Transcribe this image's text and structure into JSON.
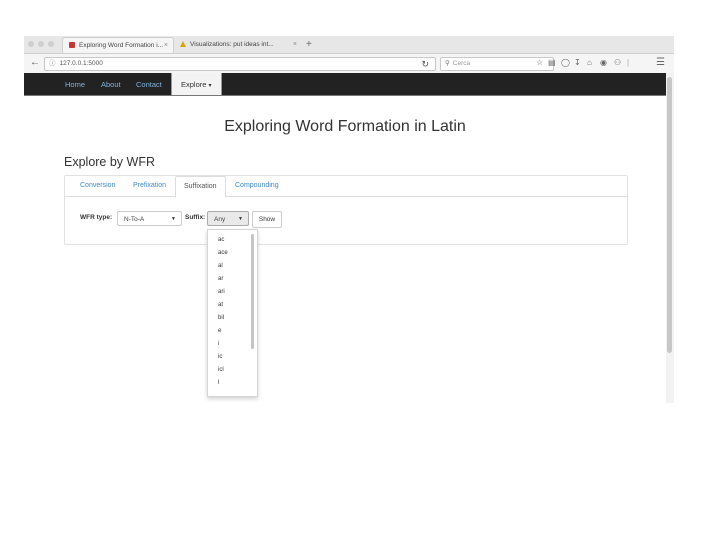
{
  "browser": {
    "tabs": [
      {
        "title": "Exploring Word Formation i...",
        "close": "×"
      },
      {
        "title": "Visualizations: put ideas int...",
        "close": "×"
      }
    ],
    "new_tab": "+",
    "url": "127.0.0.1:5000",
    "search_placeholder": "Cerca",
    "icons": [
      "star-icon",
      "reading-list-icon",
      "pocket-icon",
      "download-icon",
      "home-icon",
      "chat-icon",
      "extension-icon",
      "menu-icon"
    ]
  },
  "site_nav": {
    "items": [
      "Home",
      "About",
      "Contact"
    ],
    "active": "Explore",
    "active_caret": "▾"
  },
  "page": {
    "title": "Exploring Word Formation in Latin",
    "section": "Explore by WFR"
  },
  "wfr_tabs": [
    "Conversion",
    "Prefixation",
    "Suffixation",
    "Compounding"
  ],
  "form": {
    "wfr_type_label": "WFR type:",
    "wfr_type_value": "N-To-A",
    "suffix_label": "Suffix:",
    "suffix_value": "Any",
    "show_label": "Show"
  },
  "suffix_options": [
    "ac",
    "ace",
    "al",
    "ar",
    "ari",
    "at",
    "bil",
    "e",
    "i",
    "ic",
    "icl",
    "l"
  ],
  "colors": {
    "site_nav_bg": "#222222",
    "link": "#3e87c8",
    "nav_link": "#7fb3e0"
  }
}
